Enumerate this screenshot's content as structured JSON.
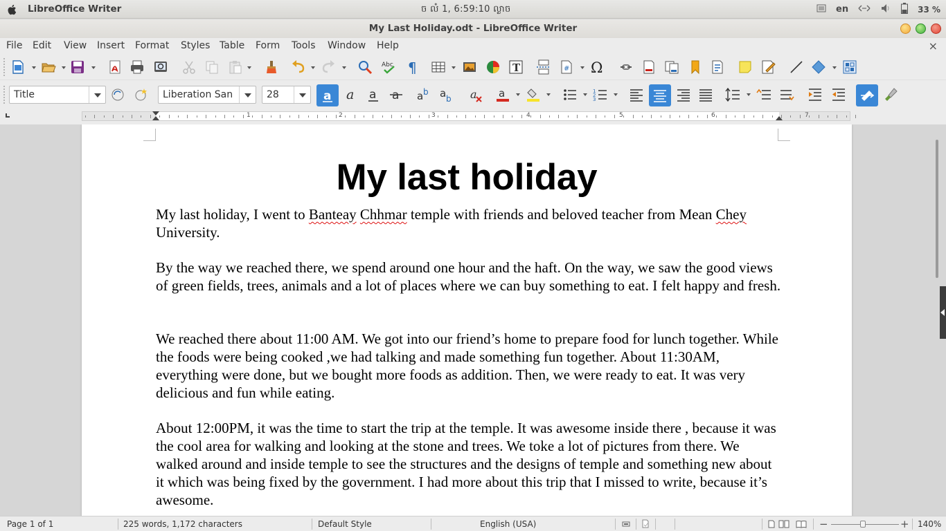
{
  "system_panel": {
    "app_name": "LibreOffice Writer",
    "clock": "ច លំ  1,  6:59:10 ល្ងាច",
    "language": "en",
    "battery": "33 %"
  },
  "window": {
    "title": "My Last Holiday.odt - LibreOffice Writer"
  },
  "menu": {
    "items": [
      "File",
      "Edit",
      "View",
      "Insert",
      "Format",
      "Styles",
      "Table",
      "Form",
      "Tools",
      "Window",
      "Help"
    ],
    "close_doc": "×"
  },
  "formatting": {
    "paragraph_style": "Title",
    "font_name": "Liberation San",
    "font_size": "28"
  },
  "ruler": {
    "labels": [
      "1",
      "2",
      "3",
      "4",
      "5",
      "6",
      "7"
    ]
  },
  "document": {
    "title": "My last holiday",
    "paragraphs": [
      {
        "pre": "My last holiday, I went to ",
        "miss1": "Banteay",
        "mid": " ",
        "miss2": "Chhmar",
        "post": " temple with friends and beloved teacher from Mean ",
        "miss3": "Chey",
        "tail": " University."
      },
      {
        "text": "By the way we reached there, we spend  around one hour and the haft. On the way, we saw the good views of green fields, trees, animals and a lot of places where we can buy something to eat. I felt happy and fresh."
      },
      {
        "text": "We reached there about 11:00 AM. We got into our friend’s home to prepare food for lunch together. While the foods were being cooked ,we had talking and made something fun together. About 11:30AM, everything were done, but we bought more foods as addition. Then, we were ready to eat. It was very delicious and fun while eating."
      },
      {
        "text": "About 12:00PM, it was the time to start the trip at the temple. It was awesome inside there , because it was the cool area for walking and looking at the stone and trees. We toke a lot of pictures from there. We walked around and inside temple to see the structures and the designs of temple and something new about it which was being fixed by the government. I had more about this trip that I missed to write, because it’s awesome."
      }
    ]
  },
  "status": {
    "page": "Page 1 of 1",
    "words": "225 words, 1,172 characters",
    "page_style": "Default Style",
    "language": "English (USA)",
    "zoom": "140%",
    "zoom_level_fraction": 0.47
  },
  "colors": {
    "accent_blue": "#3a87d6",
    "font_color_red": "#d42a20",
    "highlight_yellow": "#f7e32a"
  },
  "toolbar_icons": {
    "standard": [
      "new-document-icon",
      "open-icon",
      "save-icon",
      "export-pdf-icon",
      "print-icon",
      "print-preview-icon",
      "cut-icon",
      "copy-icon",
      "paste-icon",
      "clone-formatting-icon",
      "undo-icon",
      "redo-icon",
      "find-replace-icon",
      "spellcheck-icon",
      "formatting-marks-icon",
      "insert-table-icon",
      "insert-image-icon",
      "insert-chart-icon",
      "insert-textbox-icon",
      "page-break-icon",
      "insert-field-icon",
      "special-character-icon",
      "hyperlink-icon",
      "footnote-icon",
      "endnote-icon",
      "bookmark-icon",
      "cross-reference-icon",
      "comment-icon",
      "track-changes-icon",
      "line-icon",
      "basic-shapes-icon",
      "draw-functions-icon"
    ],
    "formatting": [
      "update-style-icon",
      "new-style-icon",
      "bold-icon",
      "italic-icon",
      "underline-icon",
      "strikethrough-icon",
      "superscript-icon",
      "subscript-icon",
      "clear-formatting-icon",
      "font-color-icon",
      "highlight-icon",
      "bullets-icon",
      "numbering-icon",
      "align-left-icon",
      "align-center-icon",
      "align-right-icon",
      "justify-icon",
      "line-spacing-icon",
      "increase-paragraph-spacing-icon",
      "decrease-paragraph-spacing-icon",
      "increase-indent-icon",
      "decrease-indent-icon",
      "sidebar-toggle-icon",
      "paint-brush-icon"
    ]
  }
}
